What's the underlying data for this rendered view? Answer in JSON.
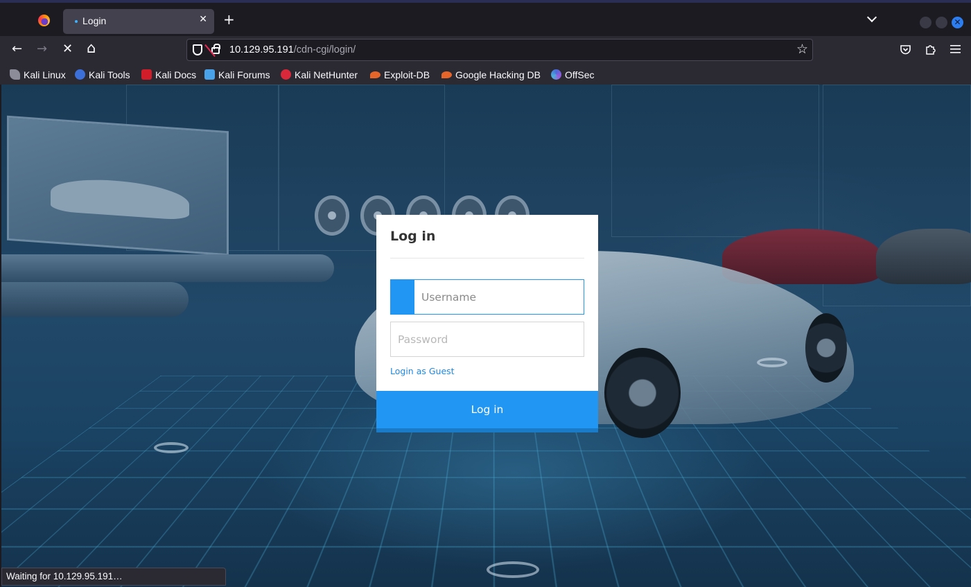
{
  "browser": {
    "tab": {
      "title": "Login"
    },
    "new_tab_symbol": "+",
    "close_symbol": "✕",
    "window_close_symbol": "✕",
    "nav": {
      "back_symbol": "←",
      "forward_symbol": "→",
      "stop_symbol": "✕",
      "home_symbol": "⌂"
    },
    "url": {
      "host": "10.129.95.191",
      "path": "/cdn-cgi/login/"
    },
    "star_symbol": "☆",
    "toolbar_icons": [
      "pocket-icon",
      "extensions-icon",
      "menu-icon"
    ],
    "bookmarks": [
      {
        "label": "Kali Linux",
        "icon": "kali-dragon-icon",
        "color": "#8c8c99"
      },
      {
        "label": "Kali Tools",
        "icon": "kali-tools-icon",
        "color": "#3d6fd9"
      },
      {
        "label": "Kali Docs",
        "icon": "kali-docs-icon",
        "color": "#d11d2a"
      },
      {
        "label": "Kali Forums",
        "icon": "kali-forums-icon",
        "color": "#4aa3e8"
      },
      {
        "label": "Kali NetHunter",
        "icon": "kali-nethunter-icon",
        "color": "#d9283a"
      },
      {
        "label": "Exploit-DB",
        "icon": "exploit-db-icon",
        "color": "#e8652a"
      },
      {
        "label": "Google Hacking DB",
        "icon": "ghdb-icon",
        "color": "#e8652a"
      },
      {
        "label": "OffSec",
        "icon": "offsec-icon",
        "color": "#4b6bd9"
      }
    ],
    "status_text": "Waiting for 10.129.95.191…"
  },
  "login": {
    "title": "Log in",
    "username_placeholder": "Username",
    "password_placeholder": "Password",
    "guest_link": "Login as Guest",
    "submit_label": "Log in",
    "accent_color": "#2196f3"
  }
}
